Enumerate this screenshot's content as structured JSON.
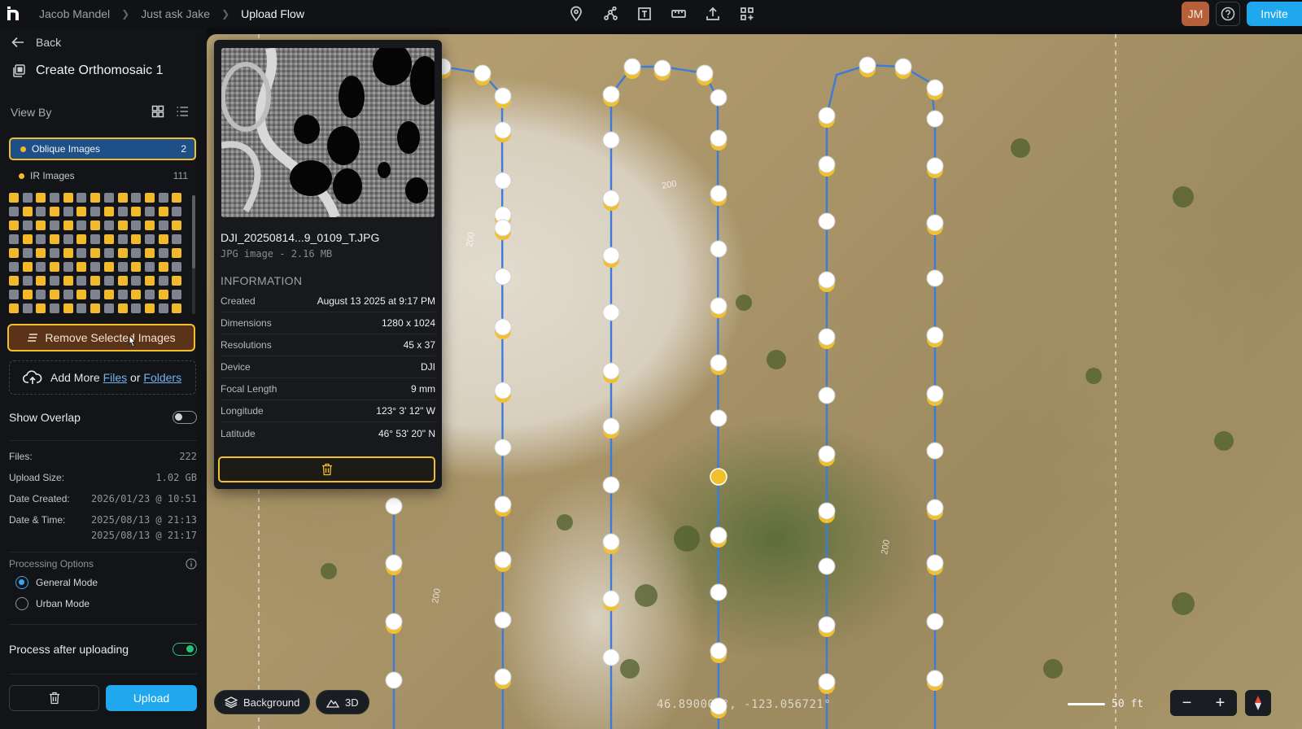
{
  "breadcrumbs": [
    "Jacob Mandel",
    "Just ask Jake",
    "Upload Flow"
  ],
  "toolbar": {
    "icons": [
      "map-pin-icon",
      "share-nodes-icon",
      "text-frame-icon",
      "ruler-icon",
      "upload-icon",
      "grid-plus-icon"
    ]
  },
  "user": {
    "initials": "JM",
    "invite_label": "Invite"
  },
  "sidebar": {
    "back_label": "Back",
    "title": "Create Orthomosaic 1",
    "view_by_label": "View By",
    "groups": [
      {
        "label": "Oblique Images",
        "count": "2"
      },
      {
        "label": "IR Images",
        "count": "111"
      }
    ],
    "remove_label": "Remove Selected Images",
    "add_more": {
      "prefix": "Add More",
      "files": "Files",
      "or": "or",
      "folders": "Folders"
    },
    "show_overlap_label": "Show Overlap",
    "show_overlap_on": false,
    "stats": {
      "files_label": "Files:",
      "files_value": "222",
      "size_label": "Upload Size:",
      "size_value": "1.02 GB",
      "created_label": "Date Created:",
      "created_value": "2026/01/23 @ 10:51",
      "datetime_label": "Date & Time:",
      "datetime_value_1": "2025/08/13 @ 21:13",
      "datetime_value_2": "2025/08/13 @ 21:17"
    },
    "processing": {
      "label": "Processing Options",
      "modes": [
        {
          "label": "General Mode",
          "checked": true
        },
        {
          "label": "Urban Mode",
          "checked": false
        }
      ]
    },
    "process_after_label": "Process after uploading",
    "process_after_on": true,
    "upload_label": "Upload"
  },
  "popup": {
    "filename": "DJI_20250814...9_0109_T.JPG",
    "filetype": "JPG image - 2.16 MB",
    "info_heading": "INFORMATION",
    "rows": [
      {
        "key": "Created",
        "value": "August 13 2025 at 9:17 PM"
      },
      {
        "key": "Dimensions",
        "value": "1280 x 1024"
      },
      {
        "key": "Resolutions",
        "value": "45 x 37"
      },
      {
        "key": "Device",
        "value": "DJI"
      },
      {
        "key": "Focal Length",
        "value": "9 mm"
      },
      {
        "key": "Longitude",
        "value": "123° 3' 12\" W"
      },
      {
        "key": "Latitude",
        "value": "46° 53' 20\" N"
      }
    ]
  },
  "map": {
    "background_label": "Background",
    "three_d_label": "3D",
    "coordinates": "46.890001°, -123.056721°",
    "scale_label": "50 ft",
    "contour_labels": [
      "200",
      "200",
      "200",
      "200"
    ]
  },
  "colors": {
    "accent": "#1fa8ee",
    "selected_yellow": "#f2c02b",
    "flight_line": "#3d7bd8",
    "thumb_yellow": "#f2b92a",
    "thumb_gray": "#7d8490"
  }
}
